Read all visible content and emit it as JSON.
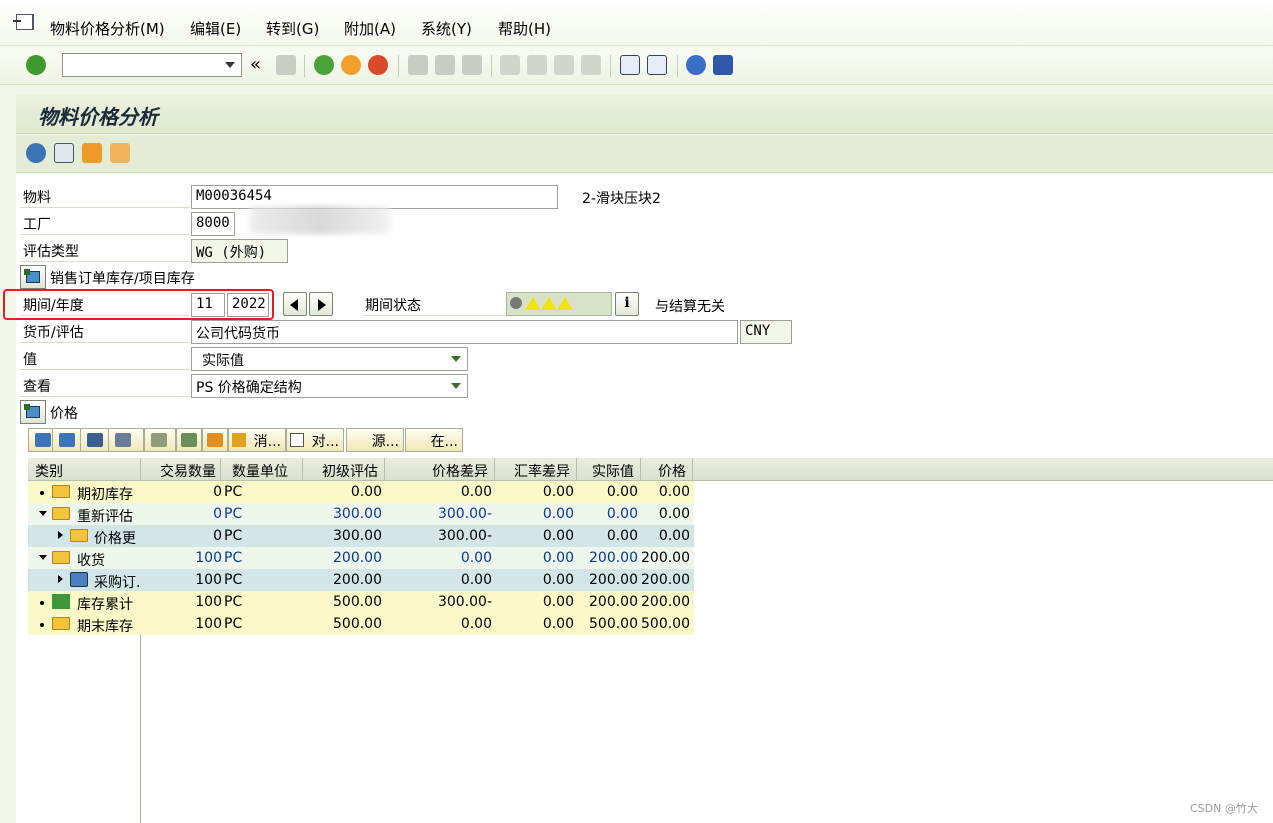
{
  "menu": [
    "物料价格分析(M)",
    "编辑(E)",
    "转到(G)",
    "附加(A)",
    "系统(Y)",
    "帮助(H)"
  ],
  "toolbar": {
    "back_symbol": "«"
  },
  "page_title": "物料价格分析",
  "form": {
    "material_label": "物料",
    "material_value": "M00036454",
    "material_desc": "2-滑块压块2",
    "plant_label": "工厂",
    "plant_value": "8000",
    "valuation_type_label": "评估类型",
    "valuation_type_value": "WG (外购)",
    "sales_order_stock_label": "销售订单库存/项目库存",
    "period_year_label": "期间/年度",
    "period_value": "11",
    "year_value": "2022",
    "period_status_label": "期间状态",
    "period_status_text": "与结算无关",
    "currency_label": "货币/评估",
    "currency_value": "公司代码货币",
    "currency_code": "CNY",
    "value_label": "值",
    "value_value": "实际值",
    "view_label": "查看",
    "view_value": "PS 价格确定结构",
    "prices_label": "价格"
  },
  "alv_buttons": [
    "消...",
    "对...",
    "源...",
    "在..."
  ],
  "grid": {
    "columns": [
      "类别",
      "交易数量",
      "数量单位",
      "初级评估",
      "价格差异",
      "汇率差异",
      "实际值",
      "价格"
    ],
    "rows": [
      {
        "name": "期初库存",
        "qty": "0",
        "unit": "PC",
        "prim": "0.00",
        "pdiff": "0.00",
        "xdiff": "0.00",
        "actual": "0.00",
        "price": "0.00"
      },
      {
        "name": "重新评估",
        "qty": "0",
        "unit": "PC",
        "prim": "300.00",
        "pdiff": "300.00-",
        "xdiff": "0.00",
        "actual": "0.00",
        "price": "0.00"
      },
      {
        "name": "价格更",
        "qty": "0",
        "unit": "PC",
        "prim": "300.00",
        "pdiff": "300.00-",
        "xdiff": "0.00",
        "actual": "0.00",
        "price": "0.00"
      },
      {
        "name": "收货",
        "qty": "100",
        "unit": "PC",
        "prim": "200.00",
        "pdiff": "0.00",
        "xdiff": "0.00",
        "actual": "200.00",
        "price": "200.00"
      },
      {
        "name": "采购订.",
        "qty": "100",
        "unit": "PC",
        "prim": "200.00",
        "pdiff": "0.00",
        "xdiff": "0.00",
        "actual": "200.00",
        "price": "200.00"
      },
      {
        "name": "库存累计",
        "qty": "100",
        "unit": "PC",
        "prim": "500.00",
        "pdiff": "300.00-",
        "xdiff": "0.00",
        "actual": "200.00",
        "price": "200.00"
      },
      {
        "name": "期末库存",
        "qty": "100",
        "unit": "PC",
        "prim": "500.00",
        "pdiff": "0.00",
        "xdiff": "0.00",
        "actual": "500.00",
        "price": "500.00"
      }
    ]
  },
  "watermark": "CSDN @竹大",
  "colors": {
    "highlight_red": "#e02020",
    "row_yellow": "#fbf9c8",
    "row_blue": "#d2e6e6",
    "row_light": "#eef5ec"
  }
}
